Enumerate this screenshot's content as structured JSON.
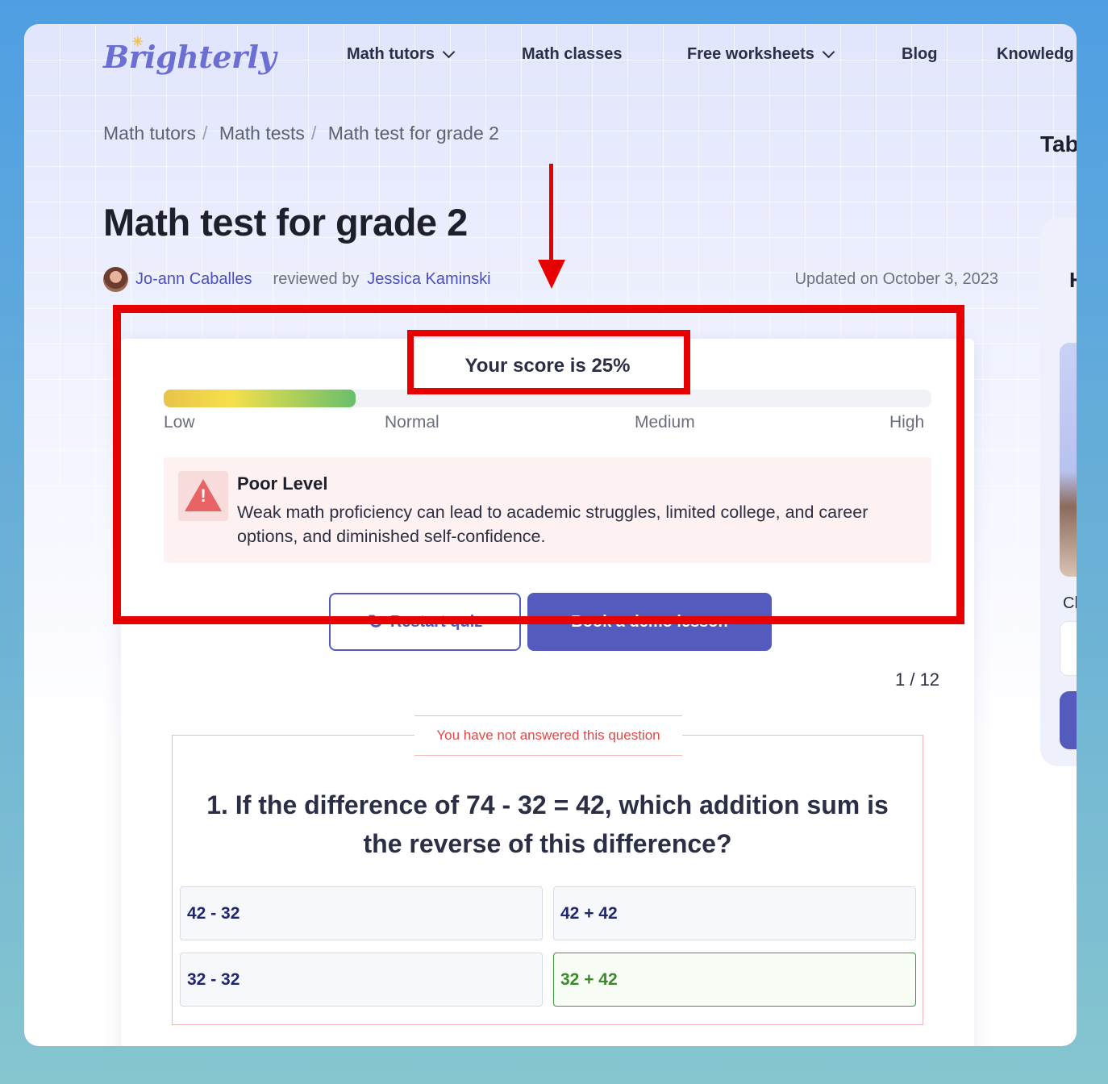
{
  "site": {
    "logo": "Brighterly"
  },
  "nav": {
    "items": [
      {
        "label": "Math tutors",
        "dropdown": true
      },
      {
        "label": "Math classes",
        "dropdown": false
      },
      {
        "label": "Free worksheets",
        "dropdown": true
      },
      {
        "label": "Blog",
        "dropdown": false
      },
      {
        "label": "Knowledg",
        "dropdown": false
      }
    ]
  },
  "breadcrumb": [
    "Math tutors",
    "Math tests",
    "Math test for grade 2"
  ],
  "page": {
    "title": "Math test for grade 2",
    "author": "Jo-ann Caballes",
    "reviewed_label": "reviewed by",
    "reviewer": "Jessica Kaminski",
    "updated": "Updated on October 3, 2023"
  },
  "sidebar": {
    "table_label": "Tab",
    "heading": "H",
    "field_label": "Cl"
  },
  "result": {
    "score_text": "Your score is 25%",
    "score_percent": 25,
    "scale": [
      "Low",
      "Normal",
      "Medium",
      "High"
    ],
    "level_title": "Poor Level",
    "level_text": "Weak math proficiency can lead to academic struggles, limited college, and career options, and diminished self-confidence.",
    "restart_label": "Restart quiz",
    "demo_label": "Book a demo lesson"
  },
  "question": {
    "counter": "1 / 12",
    "notice": "You have not answered this question",
    "text": "1. If the difference of 74 - 32 = 42, which addition sum is the reverse of this difference?",
    "options": [
      "42 - 32",
      "42 + 42",
      "32 - 32",
      "32 + 42"
    ]
  },
  "colors": {
    "brand": "#545bbd",
    "annotation": "#e60000",
    "correct": "#3a9a3a",
    "warning": "#e86363"
  }
}
